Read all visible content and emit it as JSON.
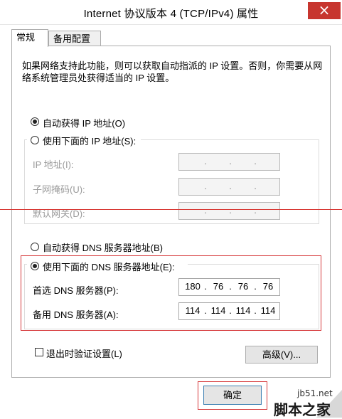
{
  "window": {
    "title": "Internet 协议版本 4 (TCP/IPv4) 属性",
    "close_glyph": "×"
  },
  "tabs": [
    {
      "label": "常规",
      "active": true
    },
    {
      "label": "备用配置",
      "active": false
    }
  ],
  "intro": {
    "line1": "如果网络支持此功能，则可以获取自动指派的 IP 设置。否则，你需要从网",
    "line2": "络系统管理员处获得适当的 IP 设置。"
  },
  "ip": {
    "auto_label": "自动获得 IP 地址(O)",
    "auto_checked": true,
    "manual_label": "使用下面的 IP 地址(S):",
    "manual_checked": false,
    "fields": [
      {
        "label": "IP 地址(I):",
        "octets": [
          "",
          "",
          "",
          ""
        ]
      },
      {
        "label": "子网掩码(U):",
        "octets": [
          "",
          "",
          "",
          ""
        ]
      },
      {
        "label": "默认网关(D):",
        "octets": [
          "",
          "",
          "",
          ""
        ]
      }
    ]
  },
  "dns": {
    "auto_label": "自动获得 DNS 服务器地址(B)",
    "auto_checked": false,
    "manual_label": "使用下面的 DNS 服务器地址(E):",
    "manual_checked": true,
    "preferred_label": "首选 DNS 服务器(P):",
    "preferred_octets": [
      "180",
      "76",
      "76",
      "76"
    ],
    "alternate_label": "备用 DNS 服务器(A):",
    "alternate_octets": [
      "114",
      "114",
      "114",
      "114"
    ]
  },
  "validate": {
    "label": "退出时验证设置(L)",
    "checked": false
  },
  "buttons": {
    "advanced": "高级(V)...",
    "ok": "确定"
  },
  "watermark": {
    "site": "jb51.net",
    "brand": "脚本之家"
  },
  "colors": {
    "highlight_red": "#d6393b",
    "close_red": "#c7362f"
  }
}
